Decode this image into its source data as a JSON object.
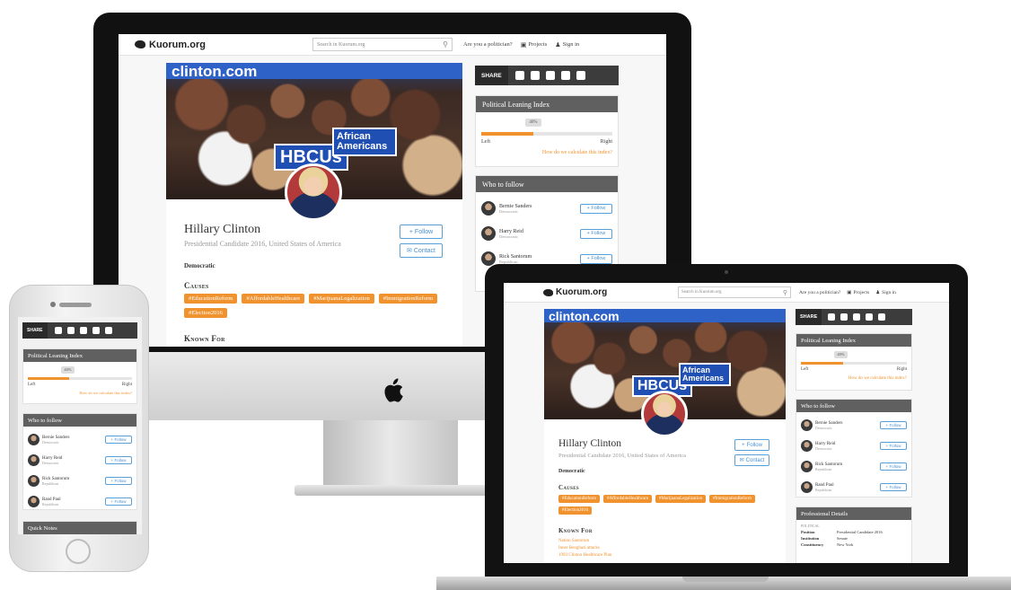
{
  "site": {
    "logo": "Kuorum.org",
    "search_placeholder": "Search in Kuorum.org",
    "politician_link": "Are you a politician?",
    "projects_link": "Projects",
    "signin_link": "Sign in"
  },
  "profile": {
    "hero_banner_top": "clinton.com",
    "hero_sign_1": "HBCUs",
    "hero_sign_2": "African Americans",
    "name": "Hillary Clinton",
    "title": "Presidential Candidate 2016, United States of America",
    "party": "Democratic",
    "follow_label": "Follow",
    "contact_label": "Contact",
    "causes_heading": "Causes",
    "causes": [
      "#EducationReform",
      "#AffordableHealthcare",
      "#MarijuanaLegalization",
      "#ImmigrationReform",
      "#Election2016"
    ],
    "known_for_heading": "Known For",
    "known_for": [
      "Nation Santorum",
      "Inner Benghazi attacks",
      "1993 Clinton Healthcare Plan"
    ]
  },
  "share": {
    "label": "SHARE",
    "icons": [
      "facebook-icon",
      "twitter-icon",
      "googleplus-icon",
      "reddit-icon",
      "linkedin-icon"
    ]
  },
  "leaning": {
    "heading": "Political Leaning Index",
    "value_label": "40%",
    "value": 0.4,
    "left": "Left",
    "right": "Right",
    "how": "How do we calculate this index?"
  },
  "who_to_follow": {
    "heading": "Who to follow",
    "people": [
      {
        "name": "Bernie Sanders",
        "party": "Democratic"
      },
      {
        "name": "Harry Reid",
        "party": "Democratic"
      },
      {
        "name": "Rick Santorum",
        "party": "Republican"
      },
      {
        "name": "Rand Paul",
        "party": "Republican"
      }
    ],
    "follow_label": "Follow"
  },
  "professional": {
    "heading": "Professional Details",
    "group": "POLITICAL",
    "rows": [
      {
        "k": "Position",
        "v": "Presidential Candidate 2016"
      },
      {
        "k": "Institution",
        "v": "Senate"
      },
      {
        "k": "Constituency",
        "v": "New York"
      }
    ]
  },
  "quick_notes": {
    "heading": "Quick Notes"
  },
  "colors": {
    "accent": "#f0922e",
    "panel_header": "#606060",
    "link_blue": "#4a90d0"
  }
}
